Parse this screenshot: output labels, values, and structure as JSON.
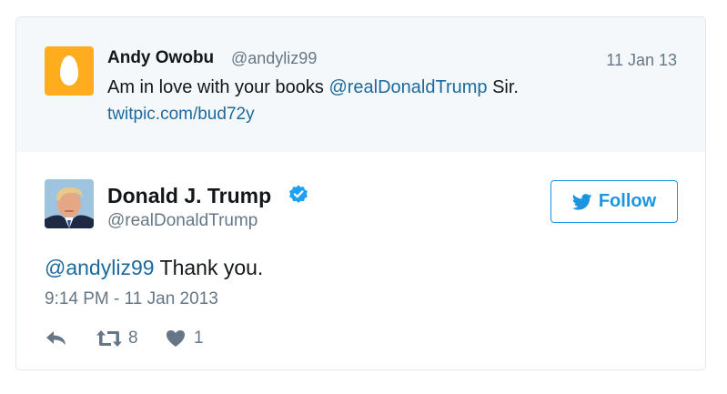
{
  "quoted_tweet": {
    "author_name": "Andy Owobu",
    "author_handle": "@andyliz99",
    "date": "11 Jan 13",
    "text_mention": "@realDonaldTrump",
    "text_before": "Am in love with your books",
    "text_after": "Sir.",
    "link": "twitpic.com/bud72y",
    "avatar_icon": "egg-icon",
    "avatar_color": "#ffad1f"
  },
  "tweet": {
    "author_name": "Donald J. Trump",
    "author_handle": "@realDonaldTrump",
    "verified_icon": "verified-badge-icon",
    "reply_mention": "@andyliz99",
    "text": "Thank you.",
    "timestamp": "9:14 PM - 11 Jan 2013"
  },
  "follow_button": {
    "label": "Follow",
    "icon": "twitter-bird-icon"
  },
  "actions": {
    "reply_icon": "reply-icon",
    "retweet_icon": "retweet-icon",
    "retweet_count": "8",
    "like_icon": "heart-icon",
    "like_count": "1"
  },
  "colors": {
    "link": "#1b6a9e",
    "accent": "#1b95e0",
    "secondary_text": "#657786",
    "quoted_bg": "#f5f8fa"
  }
}
